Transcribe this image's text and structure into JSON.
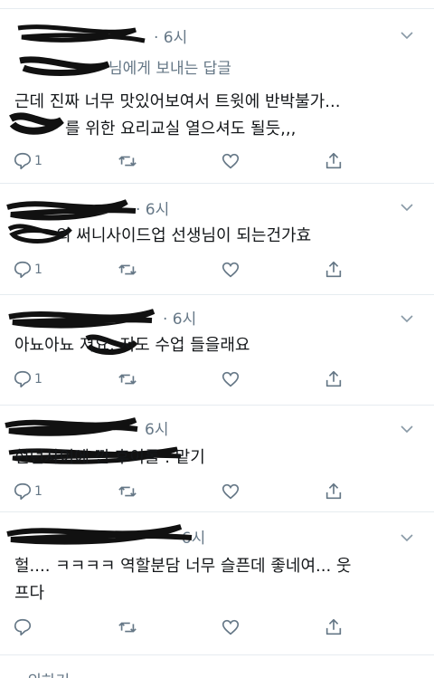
{
  "thread": {
    "footer_text": "...의하기",
    "tweets": [
      {
        "time": "· 6시",
        "reply_to": "님에게 보내는 답글",
        "lines": [
          "근데 진짜 너무 맛있어보여서 트윗에 반박불가...",
          "를 위한 요리교실 열으셔도 될듯,,,"
        ],
        "reply_count": "1"
      },
      {
        "time": "· 6시",
        "lines": [
          "의 써니사이드업 선생님이 되는건가효"
        ],
        "reply_count": "1"
      },
      {
        "time": "· 6시",
        "lines": [
          "아뇨아뇨       저요. 저도 수업 들을래요"
        ],
        "reply_count": "1"
      },
      {
        "time": "6시",
        "lines": [
          "               현던사이에 낀 후이롤 . 맡기"
        ],
        "reply_count": "1"
      },
      {
        "time": "· 6시",
        "lines": [
          "헐.... ㅋㅋㅋㅋ 역할분담 너무 슬픈데 좋네여...  웃",
          "프다"
        ],
        "reply_count": ""
      }
    ]
  },
  "colors": {
    "text": "#14171a",
    "muted": "#657786",
    "divider": "#e6ecf0",
    "scribble": "#111111"
  },
  "icons": [
    "reply-icon",
    "retweet-icon",
    "like-icon",
    "share-icon",
    "chevron-down-icon"
  ]
}
